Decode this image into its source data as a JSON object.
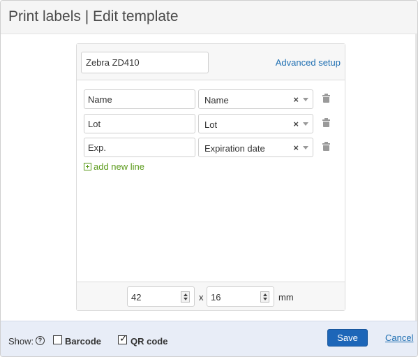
{
  "header": {
    "title": "Print labels | Edit template"
  },
  "printer": {
    "value": "Zebra ZD410",
    "advanced_label": "Advanced setup"
  },
  "lines": [
    {
      "label": "Name",
      "field": "Name"
    },
    {
      "label": "Lot",
      "field": "Lot"
    },
    {
      "label": "Exp.",
      "field": "Expiration date"
    }
  ],
  "clear_glyph": "×",
  "add_line_label": "add new line",
  "size": {
    "width": "42",
    "height": "16",
    "separator": "x",
    "unit": "mm"
  },
  "footer": {
    "show_label": "Show:",
    "help_glyph": "?",
    "barcode_label": "Barcode",
    "barcode_checked": false,
    "qr_label": "QR code",
    "qr_checked": true,
    "save_label": "Save",
    "cancel_label": "Cancel"
  },
  "colors": {
    "primary": "#1d66b8",
    "link": "#1f6fb2",
    "add": "#5a9a1a",
    "footer_bg": "#e8edf7"
  },
  "icons": {
    "delete": "trash-icon",
    "add": "plus-square-icon",
    "help": "question-circle-icon",
    "dropdown": "caret-down-icon"
  }
}
